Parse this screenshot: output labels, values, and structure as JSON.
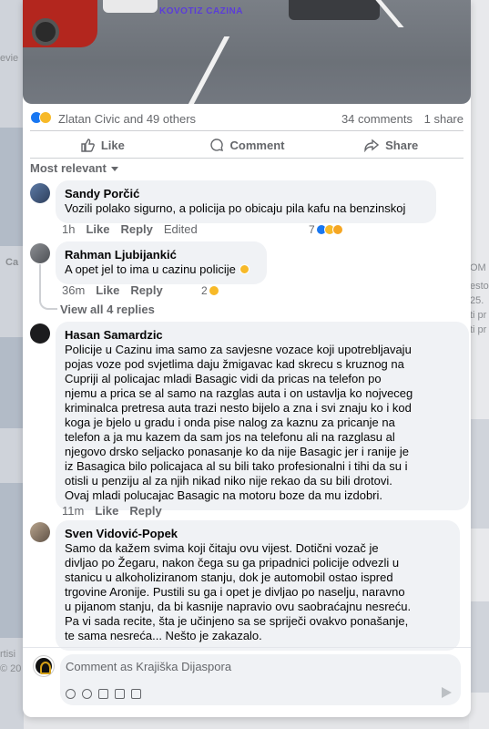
{
  "post": {
    "photo_caption": "KOVOTIZ CAZINA",
    "reactions_summary": "Zlatan Civic and 49 others",
    "comments_count": "34 comments",
    "shares_count": "1 share"
  },
  "actions": {
    "like": "Like",
    "comment": "Comment",
    "share": "Share"
  },
  "sort_label": "Most relevant",
  "comments": [
    {
      "author": "Sandy Porčić",
      "text": "Vozili polako sigurno, a policija po obicaju pila kafu na benzinskoj",
      "time": "1h",
      "like": "Like",
      "reply": "Reply",
      "edited": "Edited",
      "reactions": "7"
    },
    {
      "author": "Rahman Ljubijankić",
      "text": "A opet jel to ima u cazinu policije",
      "time": "36m",
      "like": "Like",
      "reply": "Reply",
      "reactions": "2",
      "view_replies": "View all 4 replies"
    },
    {
      "author": "Hasan Samardzic",
      "text": "Policije u Cazinu ima samo za savjesne vozace koji upotrebljavaju\npojas voze pod svjetlima daju žmigavac kad skrecu s kruznog na\nCupriji al policajac mladi Basagic vidi da pricas na telefon po\nnjemu a prica se al samo na razglas auta i on ustavlja ko nojveceg\nkriminalca pretresa auta trazi nesto bijelo a zna i svi znaju ko i kod\nkoga je bjelo u gradu i onda pise nalog za kaznu za pricanje na\ntelefon a ja mu kazem da sam jos na telefonu ali na razglasu al\nnjegovo drsko seljacko ponasanje ko da nije Basagic jer i ranije je\niz Basagica bilo policajaca al su bili tako profesionalni i tihi da su i\notisli u penziju al za njih nikad niko nije rekao da su bili drotovi.\nOvaj mladi polucajac Basagic na motoru boze da mu izdobri.",
      "time": "11m",
      "like": "Like",
      "reply": "Reply"
    },
    {
      "author": "Sven Vidović-Popek",
      "text": "Samo da kažem svima koji čitaju ovu vijest. Dotični vozač je\ndivljao po Žegaru, nakon čega su ga pripadnici policije odvezli u\nstanicu u alkoholiziranom stanju, dok je automobil ostao ispred\ntrgovine Aronije. Pustili su ga i opet je divljao po naselju, naravno\nu pijanom stanju, da bi kasnije napravio ovu saobraćajnu nesreću.\nPa vi sada recite, šta je učinjeno sa se spriječi ovakvo ponašanje,\nte sama nesreća... Nešto je zakazalo."
    }
  ],
  "composer": {
    "placeholder": "Comment as Krajiška Dijaspora"
  },
  "backdrop": {
    "left_snippet_1": "evie",
    "left_snippet_2": "Ca",
    "left_snippet_3": "rtisi",
    "left_snippet_4": "© 20",
    "right_snippet_1": "OM",
    "right_snippet_2": "esto",
    "right_snippet_3": "25.",
    "right_snippet_4": "ti pr",
    "right_snippet_5": "ti pr"
  },
  "colors": {
    "accent": "#1877f2",
    "secondary_text": "#65676b",
    "bubble": "#f0f2f5"
  }
}
